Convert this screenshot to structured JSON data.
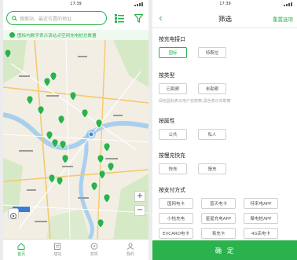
{
  "status_time": "17:39",
  "map_screen": {
    "search_placeholder": "搜索站、最近位置的地址",
    "notice": "图标内数字表示该站点空闲充电桩总数量",
    "zoom_in": "+",
    "zoom_out": "−",
    "tabs": [
      {
        "label": "首页",
        "icon": "home-icon",
        "active": true
      },
      {
        "label": "建站",
        "icon": "build-icon",
        "active": false
      },
      {
        "label": "发现",
        "icon": "discover-icon",
        "active": false
      },
      {
        "label": "我的",
        "icon": "profile-icon",
        "active": false
      }
    ]
  },
  "filter_screen": {
    "title": "筛选",
    "back": "‹",
    "reset": "重置选项",
    "sections": [
      {
        "title": "按充电接口",
        "options": [
          {
            "label": "国标",
            "selected": true
          },
          {
            "label": "特斯拉",
            "selected": false
          }
        ]
      },
      {
        "title": "按类型",
        "options": [
          {
            "label": "已勘察",
            "selected": false
          },
          {
            "label": "未勘察",
            "selected": false
          }
        ],
        "hint": "绿色圆标表示用户自勘察,黑色表示未勘察"
      },
      {
        "title": "按属性",
        "options": [
          {
            "label": "公共",
            "selected": false
          },
          {
            "label": "私人",
            "selected": false
          }
        ]
      },
      {
        "title": "按慢充快充",
        "options": [
          {
            "label": "快充",
            "selected": false
          },
          {
            "label": "慢充",
            "selected": false
          }
        ]
      },
      {
        "title": "按支付方式",
        "options": [
          {
            "label": "国网电卡",
            "selected": false
          },
          {
            "label": "普天电卡",
            "selected": false
          },
          {
            "label": "特来电APP",
            "selected": false
          },
          {
            "label": "小桔充电",
            "selected": false
          },
          {
            "label": "星星充电APP",
            "selected": false
          },
          {
            "label": "聚电桩APP",
            "selected": false
          },
          {
            "label": "EVCARD电卡",
            "selected": false
          },
          {
            "label": "易充卡",
            "selected": false
          },
          {
            "label": "4G店电卡",
            "selected": false
          }
        ]
      }
    ],
    "confirm": "确 定"
  },
  "colors": {
    "accent": "#2bb24c"
  }
}
